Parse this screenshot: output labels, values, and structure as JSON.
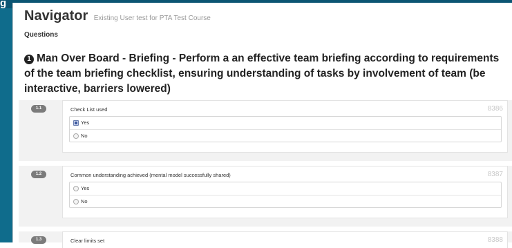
{
  "header": {
    "title": "Navigator",
    "subtitle": "Existing User test for PTA Test Course"
  },
  "section_label": "Questions",
  "question": {
    "number": "1",
    "title": "Man Over Board - Briefing - Perform a an effective team briefing according to requirements of the team briefing checklist, ensuring understanding of tasks by involvement of team (be interactive, barriers lowered)"
  },
  "items": [
    {
      "badge": "1.1",
      "label": "Check List used",
      "code": "8386",
      "options": [
        {
          "label": "Yes",
          "selected": true
        },
        {
          "label": "No",
          "selected": false
        }
      ]
    },
    {
      "badge": "1.2",
      "label": "Common understanding achieved (mental model successfully shared)",
      "code": "8387",
      "options": [
        {
          "label": "Yes",
          "selected": false
        },
        {
          "label": "No",
          "selected": false
        }
      ]
    },
    {
      "badge": "1.3",
      "label": "Clear limits set",
      "code": "8388"
    }
  ],
  "colors": {
    "sidebar": "#0f6c8c",
    "badge": "#7b7b7b",
    "code_text": "#c8c8c8"
  }
}
